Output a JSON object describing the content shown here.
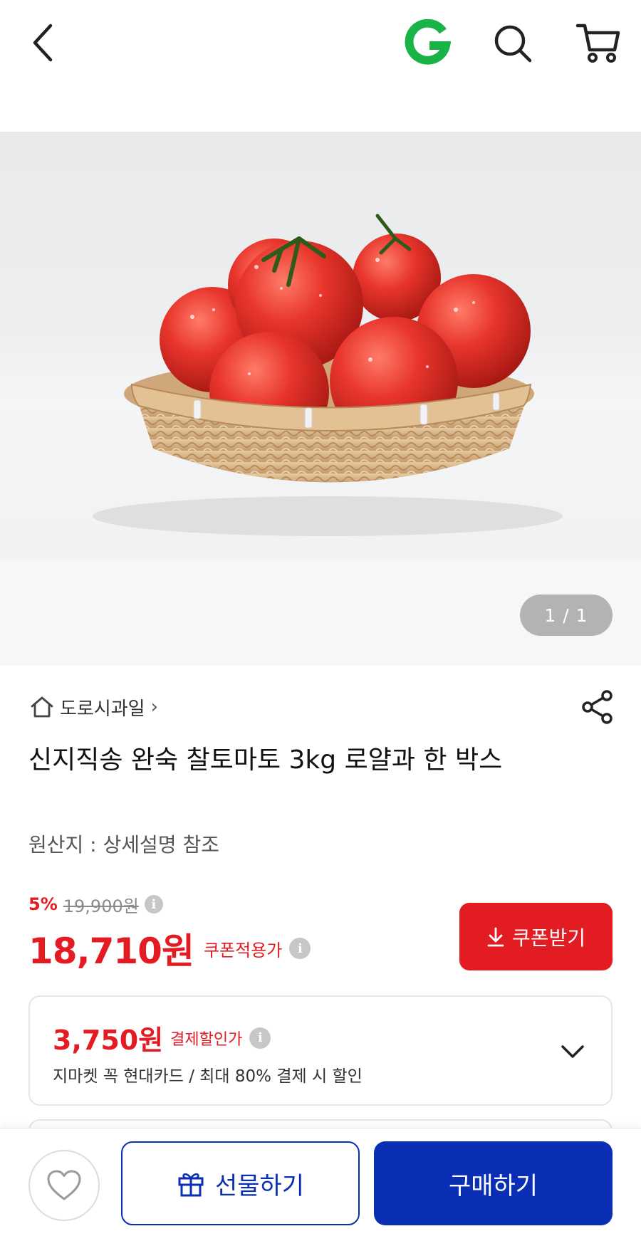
{
  "header": {
    "back_icon": "chevron-left-icon",
    "logo_text": "G",
    "brand_color": "#19b447",
    "search_icon": "search-icon",
    "cart_icon": "cart-icon"
  },
  "gallery": {
    "counter": "1 / 1",
    "image_subject": "tomatoes-in-basket"
  },
  "product": {
    "seller": "도로시과일",
    "seller_chevron": "›",
    "title": "신지직송 완숙 찰토마토 3kg 로얄과 한 박스",
    "origin": "원산지 : 상세설명 참조"
  },
  "pricing": {
    "discount_rate": "5%",
    "original_price": "19,900원",
    "sale_price": "18,710원",
    "sale_price_label": "쿠폰적용가",
    "coupon_button": "쿠폰받기",
    "accent_color": "#e31b23"
  },
  "card_offer": {
    "price": "3,750원",
    "label": "결제할인가",
    "description": "지마켓 꼭 현대카드 / 최대 80% 결제 시 할인"
  },
  "bottom_bar": {
    "wishlist_icon": "heart-icon",
    "gift_button": "선물하기",
    "buy_button": "구매하기",
    "primary_color": "#0a2eb4"
  }
}
